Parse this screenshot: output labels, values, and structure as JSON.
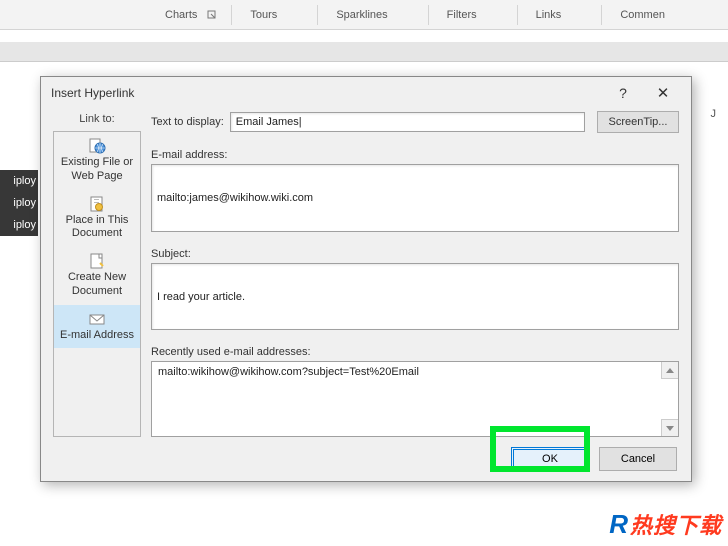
{
  "ribbon": {
    "items": [
      "Charts",
      "Tours",
      "Sparklines",
      "Filters",
      "Links",
      "Commen"
    ]
  },
  "colLetter": "J",
  "cells": [
    "iploy",
    "iploy",
    "iploy"
  ],
  "dialog": {
    "title": "Insert Hyperlink",
    "help": "?",
    "close": "✕",
    "linkTo": "Link to:",
    "nav": {
      "existing1": "Existing File or",
      "existing2": "Web Page",
      "place1": "Place in This",
      "place2": "Document",
      "create1": "Create New",
      "create2": "Document",
      "email": "E-mail Address"
    },
    "textToDisplayLabel": "Text to display:",
    "textToDisplay": "Email James",
    "screenTip": "ScreenTip...",
    "emailLabel": "E-mail address:",
    "email": "mailto:james@wikihow.wiki.com",
    "subjectLabel": "Subject:",
    "subject": "I read your article.",
    "recentLabel": "Recently used e-mail addresses:",
    "recent": "mailto:wikihow@wikihow.com?subject=Test%20Email",
    "ok": "OK",
    "cancel": "Cancel"
  },
  "watermark": {
    "r": "R",
    "text": "热搜下载"
  }
}
